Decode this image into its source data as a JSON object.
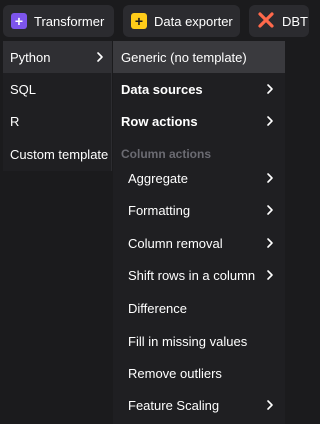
{
  "toolbar": {
    "transformer": {
      "label": "Transformer",
      "icon": "plus-icon",
      "color": "#7d55ec"
    },
    "data_exporter": {
      "label": "Data exporter",
      "icon": "plus-icon",
      "color": "#ffcc19"
    },
    "dbt": {
      "label": "DBT",
      "icon": "dbt-logo-icon",
      "color": "#ff694b"
    }
  },
  "language_menu": {
    "items": [
      {
        "label": "Python",
        "has_submenu": true,
        "active": true
      },
      {
        "label": "SQL"
      },
      {
        "label": "R"
      },
      {
        "label": "Custom template"
      }
    ]
  },
  "python_submenu": {
    "generic": "Generic (no template)",
    "data_sources": "Data sources",
    "row_actions": "Row actions",
    "column_actions_header": "Column actions",
    "column_actions": [
      {
        "label": "Aggregate",
        "has_submenu": true
      },
      {
        "label": "Formatting",
        "has_submenu": true
      },
      {
        "label": "Column removal",
        "has_submenu": true
      },
      {
        "label": "Shift rows in a column",
        "has_submenu": true
      },
      {
        "label": "Difference"
      },
      {
        "label": "Fill in missing values"
      },
      {
        "label": "Remove outliers"
      },
      {
        "label": "Feature Scaling",
        "has_submenu": true
      }
    ]
  }
}
